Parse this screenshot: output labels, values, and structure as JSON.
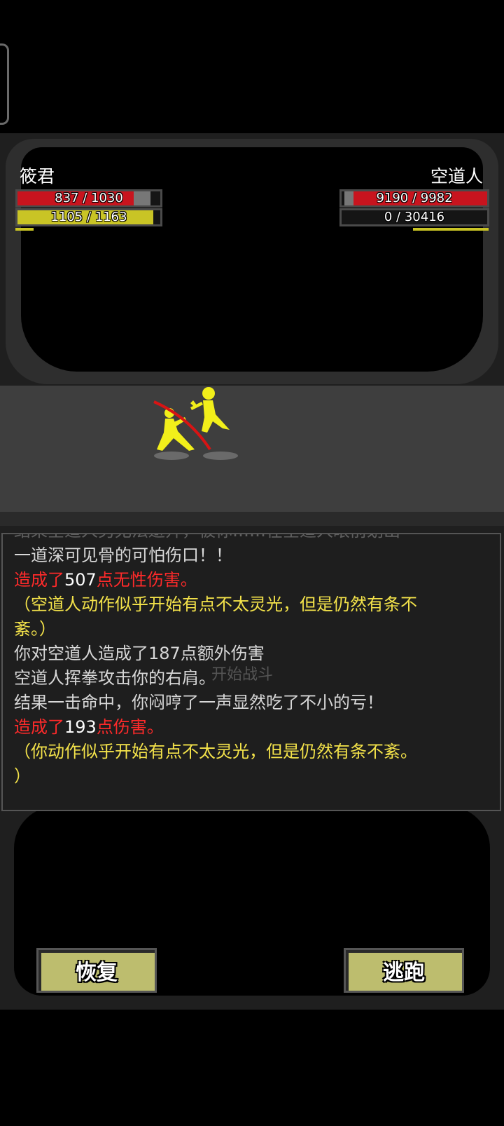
{
  "player": {
    "name": "筱君",
    "hp_text": "837 / 1030",
    "hp_fraction": 0.813,
    "mp_text": "1105 / 1163",
    "mp_fraction": 0.95
  },
  "enemy": {
    "name": "空道人",
    "hp_text": "9190 / 9982",
    "hp_fraction": 0.92,
    "mp_text": "0 / 30416",
    "mp_fraction": 0
  },
  "log": {
    "ghost_text": "开始战斗",
    "line0_partial": "结果空道人另无法避开，被你……在空道人眼前划出",
    "line1": "一道深可见骨的可怕伤口！！",
    "line2_a": "造成了",
    "line2_num": "507",
    "line2_b": "点无性伤害。",
    "line3": "（空道人动作似乎开始有点不太灵光，但是仍然有条不",
    "line4": "紊。）",
    "line5": "你对空道人造成了187点额外伤害",
    "line6": "空道人挥拳攻击你的右肩。",
    "line7": "结果一击命中，你闷哼了一声显然吃了不小的亏！",
    "line8_a": "造成了",
    "line8_num": "193",
    "line8_b": "点伤害。",
    "line9": "（你动作似乎开始有点不太灵光，但是仍然有条不紊。",
    "line10": "）"
  },
  "buttons": {
    "recover": "恢复",
    "flee": "逃跑"
  },
  "colors": {
    "hp": "#c8141e",
    "mp": "#c9c425",
    "damage": "#ff2a2a",
    "status": "#f4e34a",
    "button": "#bdbd6e"
  }
}
